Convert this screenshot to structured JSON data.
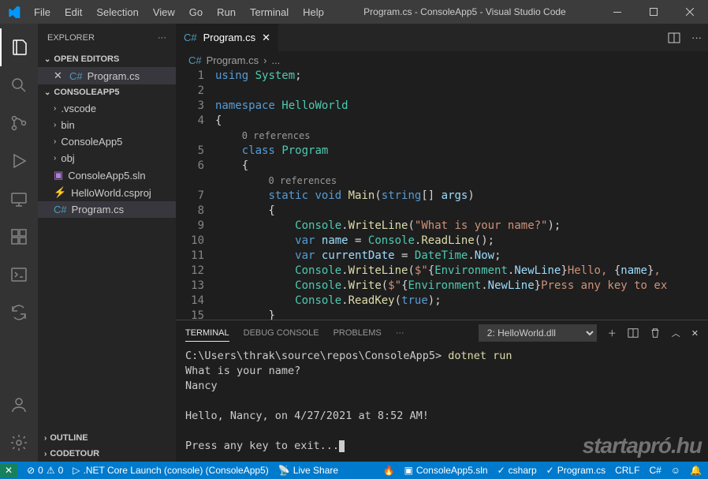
{
  "title": "Program.cs - ConsoleApp5 - Visual Studio Code",
  "menu": [
    "File",
    "Edit",
    "Selection",
    "View",
    "Go",
    "Run",
    "Terminal",
    "Help"
  ],
  "explorer": {
    "title": "EXPLORER",
    "open_editors": "OPEN EDITORS",
    "open_editor_item": "Program.cs",
    "workspace": "CONSOLEAPP5",
    "tree": {
      "vscode": ".vscode",
      "bin": "bin",
      "consoleapp5": "ConsoleApp5",
      "obj": "obj",
      "sln": "ConsoleApp5.sln",
      "csproj": "HelloWorld.csproj",
      "program": "Program.cs"
    },
    "outline": "OUTLINE",
    "codetour": "CODETOUR"
  },
  "tab": {
    "name": "Program.cs"
  },
  "breadcrumb": {
    "file": "Program.cs",
    "sep": "›",
    "rest": "..."
  },
  "code": {
    "lines": [
      "1",
      "2",
      "3",
      "4",
      "",
      "5",
      "6",
      "",
      "7",
      "8",
      "9",
      "10",
      "11",
      "12",
      "13",
      "14",
      "15"
    ],
    "codelens1": "0 references",
    "codelens2": "0 references",
    "t": {
      "using": "using",
      "system": "System",
      "namespace": "namespace",
      "helloworld": "HelloWorld",
      "class": "class",
      "program": "Program",
      "static": "static",
      "void": "void",
      "main": "Main",
      "string": "string",
      "args": "args",
      "console": "Console",
      "writeline": "WriteLine",
      "write": "Write",
      "readline": "ReadLine",
      "readkey": "ReadKey",
      "q": "\"What is your name?\"",
      "var": "var",
      "name": "name",
      "currentdate": "currentDate",
      "datetime": "DateTime",
      "now": "Now",
      "dollar1a": "$\"",
      "env": "Environment",
      "newline": "NewLine",
      "hello": "Hello, ",
      "comma": ", ",
      "press": "Press any key to ex",
      "true": "true",
      "closebrace": "}"
    }
  },
  "panel": {
    "tabs": {
      "terminal": "TERMINAL",
      "debug": "DEBUG CONSOLE",
      "problems": "PROBLEMS"
    },
    "select": "2: HelloWorld.dll",
    "terminal": {
      "prompt": "C:\\Users\\thrak\\source\\repos\\ConsoleApp5>",
      "cmd": "dotnet run",
      "out1": "What is your name?",
      "out2": "Nancy",
      "out3": "Hello, Nancy, on 4/27/2021 at 8:52 AM!",
      "out4": "Press any key to exit..."
    }
  },
  "status": {
    "errors": "0",
    "warnings": "0",
    "launch": ".NET Core Launch (console) (ConsoleApp5)",
    "liveshare": "Live Share",
    "sln": "ConsoleApp5.sln",
    "csharp": "csharp",
    "program": "Program.cs",
    "encoding": "CRLF",
    "lang": "C#"
  },
  "watermark": "startapró.hu"
}
